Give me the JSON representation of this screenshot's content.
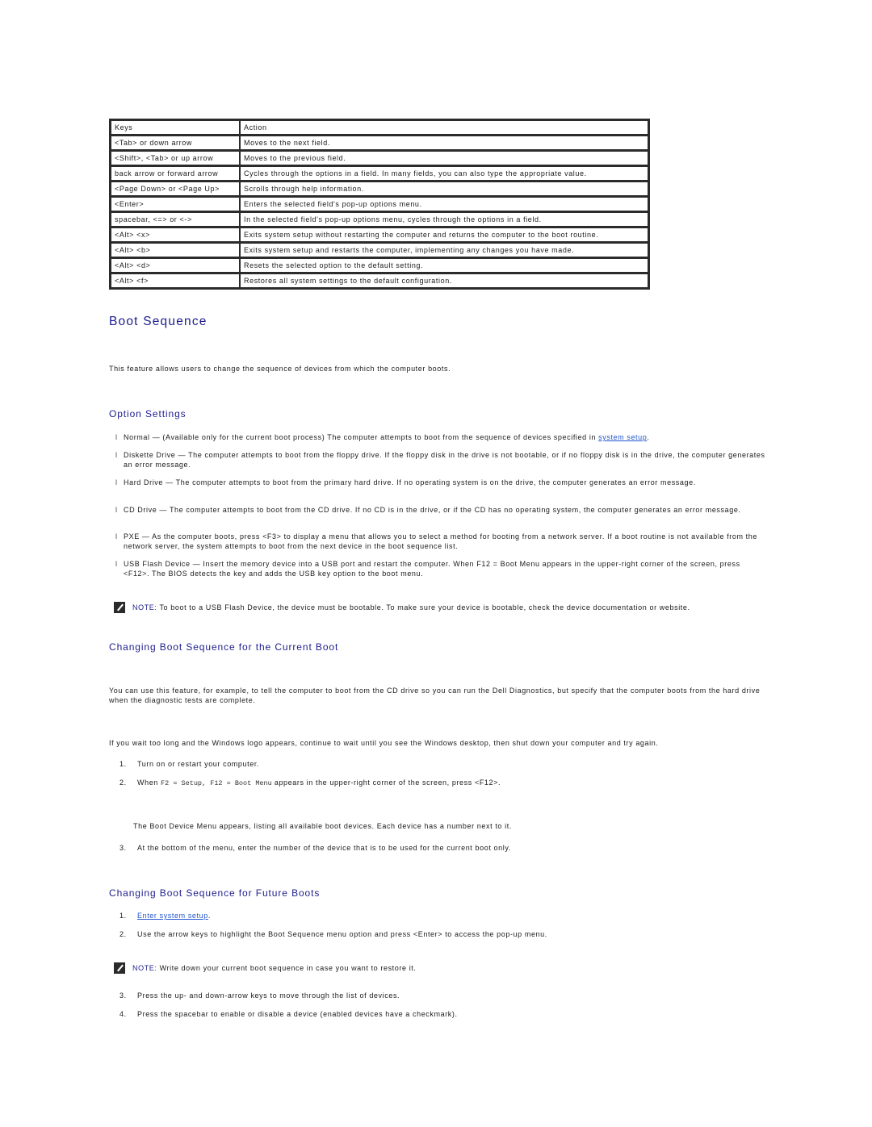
{
  "keys_table": {
    "headers": [
      "Keys",
      "Action"
    ],
    "rows": [
      [
        "<Tab> or down arrow",
        "Moves to the next field."
      ],
      [
        "<Shift>, <Tab> or up arrow",
        "Moves to the previous field."
      ],
      [
        "back arrow or forward arrow",
        "Cycles through the options in a field. In many fields, you can also type the appropriate value."
      ],
      [
        "<Page Down> or <Page Up>",
        "Scrolls through help information."
      ],
      [
        "<Enter>",
        "Enters the selected field's pop-up options menu."
      ],
      [
        "spacebar, <=> or <->",
        "In the selected field's pop-up options menu, cycles through the options in a field."
      ],
      [
        "<Alt> <x>",
        "Exits system setup without restarting the computer and returns the computer to the boot routine."
      ],
      [
        "<Alt> <b>",
        "Exits system setup and restarts the computer, implementing any changes you have made."
      ],
      [
        "<Alt> <d>",
        "Resets the selected option to the default setting."
      ],
      [
        "<Alt> <f>",
        "Restores all system settings to the default configuration."
      ]
    ]
  },
  "boot_sequence": {
    "title": "Boot Sequence",
    "intro": "This feature allows users to change the sequence of devices from which the computer boots."
  },
  "option_settings": {
    "title": "Option Settings",
    "bullet_glyph": "l",
    "items": [
      {
        "lead": "Normal —",
        "text": " (Available only for the current boot process) The computer attempts to boot from the sequence of devices specified in ",
        "link": "system setup",
        "tail": "."
      },
      {
        "lead": "Diskette Drive —",
        "text": " The computer attempts to boot from the floppy drive. If the floppy disk in the drive is not bootable, or if no floppy disk is in the drive, the computer generates an error message."
      },
      {
        "lead": "Hard Drive —",
        "text": " The computer attempts to boot from the primary hard drive. If no operating system is on the drive, the computer generates an error message."
      },
      {
        "lead": "CD Drive —",
        "text": " The computer attempts to boot from the CD drive. If no CD is in the drive, or if the CD has no operating system, the computer generates an error message."
      },
      {
        "lead": "PXE —",
        "text": " As the computer boots, press <F3> to display a menu that allows you to select a method for booting from a network server. If a boot routine is not available from the network server, the system attempts to boot from the next device in the boot sequence list."
      },
      {
        "lead": "USB Flash Device —",
        "text": " Insert the memory device into a USB port and restart the computer. When F12 = Boot Menu appears in the upper-right corner of the screen, press <F12>. The BIOS detects the key and adds the USB key option to the boot menu."
      }
    ],
    "note": {
      "label": "NOTE:",
      "text": " To boot to a USB Flash Device, the device must be bootable. To make sure your device is bootable, check the device documentation or website."
    }
  },
  "current_boot": {
    "title": "Changing Boot Sequence for the Current Boot",
    "para1": "You can use this feature, for example, to tell the computer to boot from the CD drive so you can run the Dell Diagnostics, but specify that the computer boots from the hard drive when the diagnostic tests are complete.",
    "para2": "If you wait too long and the Windows logo appears, continue to wait until you see the Windows desktop, then shut down your computer and try again.",
    "steps": [
      {
        "num": "1.",
        "text": "Turn on or restart your computer."
      },
      {
        "num": "2.",
        "pre": "When ",
        "code": "F2 = Setup, F12 = Boot Menu",
        "post": " appears in the upper-right corner of the screen, press <F12>."
      },
      {
        "num": "3.",
        "text": "At the bottom of the menu, enter the number of the device that is to be used for the current boot only."
      }
    ],
    "step2_followup": "The Boot Device Menu appears, listing all available boot devices. Each device has a number next to it."
  },
  "future_boots": {
    "title": "Changing Boot Sequence for Future Boots",
    "steps": [
      {
        "num": "1.",
        "link": "Enter system setup",
        "tail": "."
      },
      {
        "num": "2.",
        "text": "Use the arrow keys to highlight the Boot Sequence menu option and press <Enter> to access the pop-up menu."
      },
      {
        "num": "3.",
        "text": "Press the up- and down-arrow keys to move through the list of devices."
      },
      {
        "num": "4.",
        "text": "Press the spacebar to enable or disable a device (enabled devices have a checkmark)."
      }
    ],
    "note": {
      "label": "NOTE:",
      "text": " Write down your current boot sequence in case you want to restore it."
    }
  },
  "colors": {
    "heading": "#1c1c8c",
    "link": "#2255cc",
    "text": "#1a1a1a"
  }
}
